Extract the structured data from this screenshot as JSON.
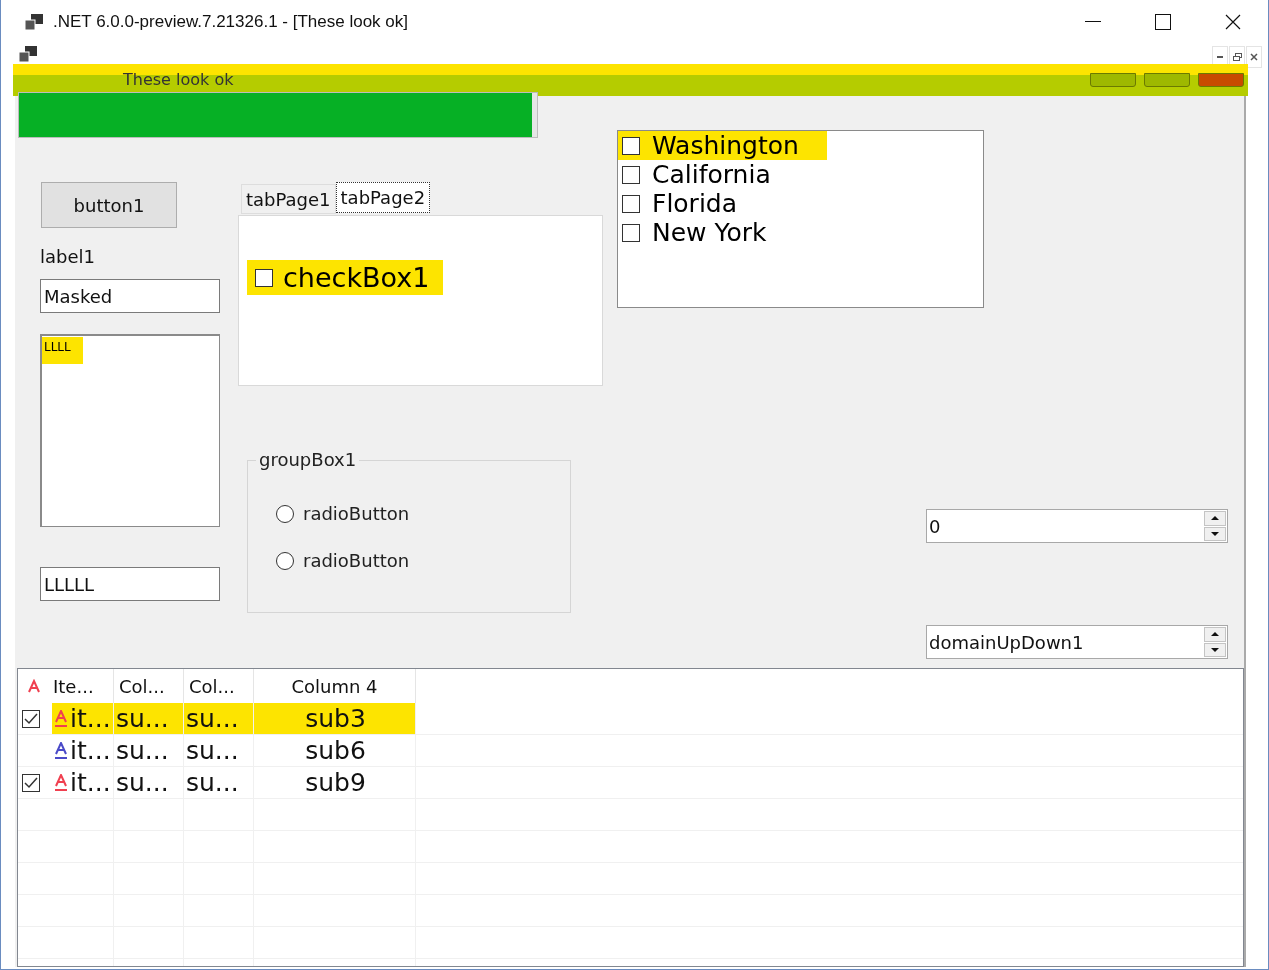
{
  "window": {
    "title": ".NET 6.0.0-preview.7.21326.1 - [These look ok]"
  },
  "child_window": {
    "title": "These look ok",
    "highlighted": true
  },
  "progress_bar": {
    "level": 0.99
  },
  "button": {
    "label": "button1"
  },
  "label": {
    "text": "label1"
  },
  "masked_textbox": {
    "value": "Masked"
  },
  "listbox": {
    "items": [
      {
        "text": "LLLL",
        "highlighted": true
      }
    ]
  },
  "textbox": {
    "value": "LLLLL"
  },
  "tabs": [
    {
      "label": "tabPage1",
      "selected": false
    },
    {
      "label": "tabPage2",
      "selected": true
    }
  ],
  "tab_checkbox": {
    "label": "checkBox1",
    "checked": false,
    "highlighted": true
  },
  "group_box": {
    "title": "groupBox1",
    "radios": [
      {
        "label": "radioButton",
        "selected": false
      },
      {
        "label": "radioButton",
        "selected": false
      }
    ]
  },
  "checked_listbox": {
    "items": [
      {
        "label": "Washington",
        "checked": false,
        "highlighted": true
      },
      {
        "label": "California",
        "checked": false,
        "highlighted": false
      },
      {
        "label": "Florida",
        "checked": false,
        "highlighted": false
      },
      {
        "label": "New York",
        "checked": false,
        "highlighted": false
      }
    ]
  },
  "numeric_updown": {
    "value": "0"
  },
  "domain_updown": {
    "value": "domainUpDown1"
  },
  "listview": {
    "columns": [
      "Ite...",
      "Col...",
      "Col...",
      "Column 4"
    ],
    "rows": [
      {
        "checked": true,
        "color": "#f04050",
        "highlighted": true,
        "cells": [
          "it...",
          "su...",
          "su...",
          "sub3"
        ]
      },
      {
        "checked": false,
        "color": "#4a4ac8",
        "highlighted": false,
        "cells": [
          "it...",
          "su...",
          "su...",
          "sub6"
        ]
      },
      {
        "checked": true,
        "color": "#f04050",
        "highlighted": false,
        "cells": [
          "it...",
          "su...",
          "su...",
          "sub9"
        ]
      }
    ]
  }
}
